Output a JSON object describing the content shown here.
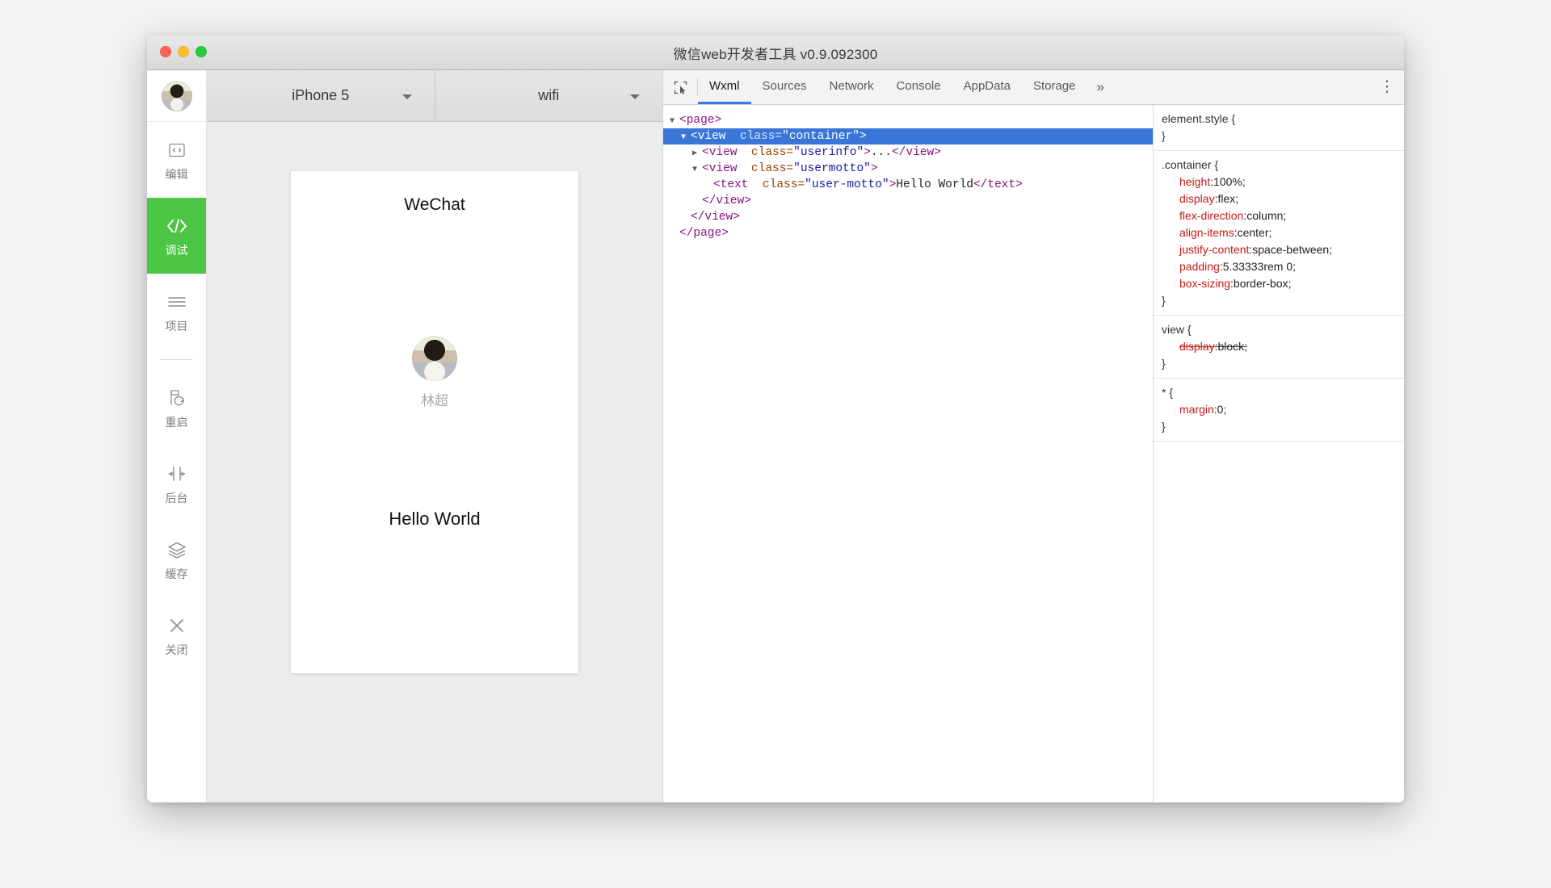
{
  "window": {
    "title": "微信web开发者工具 v0.9.092300",
    "traffic": {
      "close": "close-button",
      "minimize": "minimize-button",
      "zoom": "zoom-button"
    }
  },
  "sidebar": {
    "avatar": "user-avatar",
    "items": [
      {
        "label": "编辑",
        "icon": "code-box-icon",
        "active": false
      },
      {
        "label": "调试",
        "icon": "code-brackets-icon",
        "active": true
      },
      {
        "label": "项目",
        "icon": "list-lines-icon",
        "active": false
      },
      {
        "label": "重启",
        "icon": "restart-icon",
        "active": false
      },
      {
        "label": "后台",
        "icon": "collapse-arrows-icon",
        "active": false
      },
      {
        "label": "缓存",
        "icon": "layers-icon",
        "active": false
      },
      {
        "label": "关闭",
        "icon": "close-x-icon",
        "active": false
      }
    ]
  },
  "simulator": {
    "device": "iPhone 5",
    "network": "wifi",
    "screen": {
      "title": "WeChat",
      "nickname": "林超",
      "motto": "Hello World"
    }
  },
  "devtools": {
    "inspect_icon": "inspect-element-icon",
    "tabs": [
      {
        "label": "Wxml",
        "active": true
      },
      {
        "label": "Sources",
        "active": false
      },
      {
        "label": "Network",
        "active": false
      },
      {
        "label": "Console",
        "active": false
      },
      {
        "label": "AppData",
        "active": false
      },
      {
        "label": "Storage",
        "active": false
      }
    ],
    "more_tabs_label": "»",
    "menu_icon": "kebab-menu-icon",
    "dom_tree": [
      {
        "indent": 0,
        "arrow": "open",
        "selected": false,
        "parts": [
          {
            "t": "tag",
            "v": "<page>"
          }
        ]
      },
      {
        "indent": 1,
        "arrow": "open",
        "selected": true,
        "parts": [
          {
            "t": "tag",
            "v": "<view"
          },
          {
            "t": "attrname",
            "v": "class="
          },
          {
            "t": "attrval",
            "v": "\"container\""
          },
          {
            "t": "tag",
            "v": ">"
          }
        ]
      },
      {
        "indent": 2,
        "arrow": "closed",
        "selected": false,
        "parts": [
          {
            "t": "tag",
            "v": "<view"
          },
          {
            "t": "attrname",
            "v": "class="
          },
          {
            "t": "attrval",
            "v": "\"userinfo\""
          },
          {
            "t": "tag",
            "v": ">"
          },
          {
            "t": "text",
            "v": "..."
          },
          {
            "t": "tag",
            "v": "</view>"
          }
        ]
      },
      {
        "indent": 2,
        "arrow": "open",
        "selected": false,
        "parts": [
          {
            "t": "tag",
            "v": "<view"
          },
          {
            "t": "attrname",
            "v": "class="
          },
          {
            "t": "attrval",
            "v": "\"usermotto\""
          },
          {
            "t": "tag",
            "v": ">"
          }
        ]
      },
      {
        "indent": 3,
        "arrow": "none",
        "selected": false,
        "parts": [
          {
            "t": "tag",
            "v": "<text"
          },
          {
            "t": "attrname",
            "v": "class="
          },
          {
            "t": "attrval",
            "v": "\"user-motto\""
          },
          {
            "t": "tag",
            "v": ">"
          },
          {
            "t": "text",
            "v": "Hello World"
          },
          {
            "t": "tag",
            "v": "</text>"
          }
        ]
      },
      {
        "indent": 2,
        "arrow": "none",
        "selected": false,
        "parts": [
          {
            "t": "tag",
            "v": "</view>"
          }
        ]
      },
      {
        "indent": 1,
        "arrow": "none",
        "selected": false,
        "parts": [
          {
            "t": "tag",
            "v": "</view>"
          }
        ]
      },
      {
        "indent": 0,
        "arrow": "none",
        "selected": false,
        "parts": [
          {
            "t": "tag",
            "v": "</page>"
          }
        ]
      }
    ],
    "styles": [
      {
        "selector": "element.style {",
        "close": "}",
        "props": []
      },
      {
        "selector": ".container {",
        "close": "}",
        "props": [
          {
            "name": "height",
            "value": "100%",
            "struck": false
          },
          {
            "name": "display",
            "value": "flex",
            "struck": false
          },
          {
            "name": "flex-direction",
            "value": "column",
            "struck": false
          },
          {
            "name": "align-items",
            "value": "center",
            "struck": false
          },
          {
            "name": "justify-content",
            "value": "space-between",
            "struck": false
          },
          {
            "name": "padding",
            "value": "5.33333rem 0",
            "struck": false
          },
          {
            "name": "box-sizing",
            "value": "border-box",
            "struck": false
          }
        ]
      },
      {
        "selector": "view {",
        "close": "}",
        "props": [
          {
            "name": "display",
            "value": "block",
            "struck": true
          }
        ]
      },
      {
        "selector": "* {",
        "close": "}",
        "props": [
          {
            "name": "margin",
            "value": "0",
            "struck": false
          }
        ]
      }
    ]
  },
  "colors": {
    "accent_green": "#4cc644",
    "selection_blue": "#3a76d8",
    "tab_underline": "#3b78e7",
    "tag_purple": "#881280",
    "attr_orange": "#994500",
    "value_blue": "#1a1aa6",
    "css_prop_red": "#c41a16"
  }
}
